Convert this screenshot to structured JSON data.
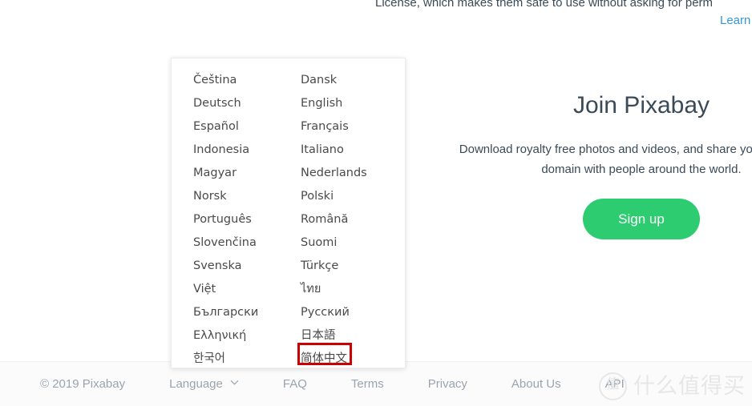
{
  "page": {
    "license_text": "License, which makes them safe to use without asking for perm",
    "learn_link": "Learn",
    "hero_title": "Join Pixabay",
    "hero_sub_line1": "Download royalty free photos and videos, and share your own public",
    "hero_sub_line2": "domain with people around the world.",
    "signup_label": "Sign up"
  },
  "footer": {
    "copyright": "© 2019 Pixabay",
    "language_label": "Language",
    "language_icon": "chevron-down-icon",
    "links": [
      {
        "label": "FAQ"
      },
      {
        "label": "Terms"
      },
      {
        "label": "Privacy"
      },
      {
        "label": "About Us"
      },
      {
        "label": "API"
      }
    ]
  },
  "watermark": {
    "badge": "值",
    "text": "什么值得买"
  },
  "language_dropdown": {
    "open": true,
    "selected": "简体中文",
    "highlight_color": "#cc0000",
    "left_column": [
      {
        "label": "Čeština"
      },
      {
        "label": "Deutsch"
      },
      {
        "label": "Español"
      },
      {
        "label": "Indonesia"
      },
      {
        "label": "Magyar"
      },
      {
        "label": "Norsk"
      },
      {
        "label": "Português"
      },
      {
        "label": "Slovenčina"
      },
      {
        "label": "Svenska"
      },
      {
        "label": "Việt"
      },
      {
        "label": "Български"
      },
      {
        "label": "Ελληνική"
      },
      {
        "label": "한국어"
      }
    ],
    "right_column": [
      {
        "label": "Dansk"
      },
      {
        "label": "English"
      },
      {
        "label": "Français"
      },
      {
        "label": "Italiano"
      },
      {
        "label": "Nederlands"
      },
      {
        "label": "Polski"
      },
      {
        "label": "Română"
      },
      {
        "label": "Suomi"
      },
      {
        "label": "Türkçe"
      },
      {
        "label": "ไทย"
      },
      {
        "label": "Русский"
      },
      {
        "label": "日本語"
      },
      {
        "label": "简体中文"
      }
    ]
  },
  "colors": {
    "accent_green": "#2ecc71",
    "link_blue": "#3498db",
    "highlight_red": "#cc0000",
    "text_dark": "#3a4a57",
    "text_muted": "#9aa4ad"
  }
}
